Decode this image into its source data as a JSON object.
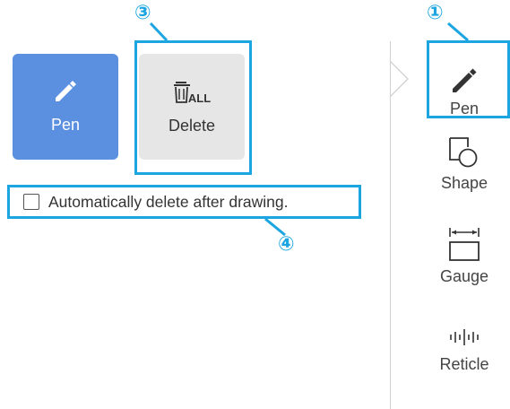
{
  "left_panel": {
    "pen_button": {
      "label": "Pen",
      "icon": "pencil-icon"
    },
    "delete_button": {
      "label": "Delete",
      "icon": "trash-all-icon",
      "icon_text": "ALL"
    },
    "auto_delete_checkbox": {
      "label": "Automatically delete after drawing.",
      "checked": false
    }
  },
  "right_toolbar": {
    "items": [
      {
        "label": "Pen",
        "icon": "pencil-icon",
        "selected": true
      },
      {
        "label": "Shape",
        "icon": "shape-icon"
      },
      {
        "label": "Gauge",
        "icon": "gauge-icon"
      },
      {
        "label": "Reticle",
        "icon": "reticle-icon"
      }
    ]
  },
  "callouts": {
    "c1": "①",
    "c3": "③",
    "c4": "④"
  },
  "colors": {
    "accent": "#1ca5e0",
    "pen_button_bg": "#5b8fe0",
    "delete_button_bg": "#e6e6e6"
  }
}
